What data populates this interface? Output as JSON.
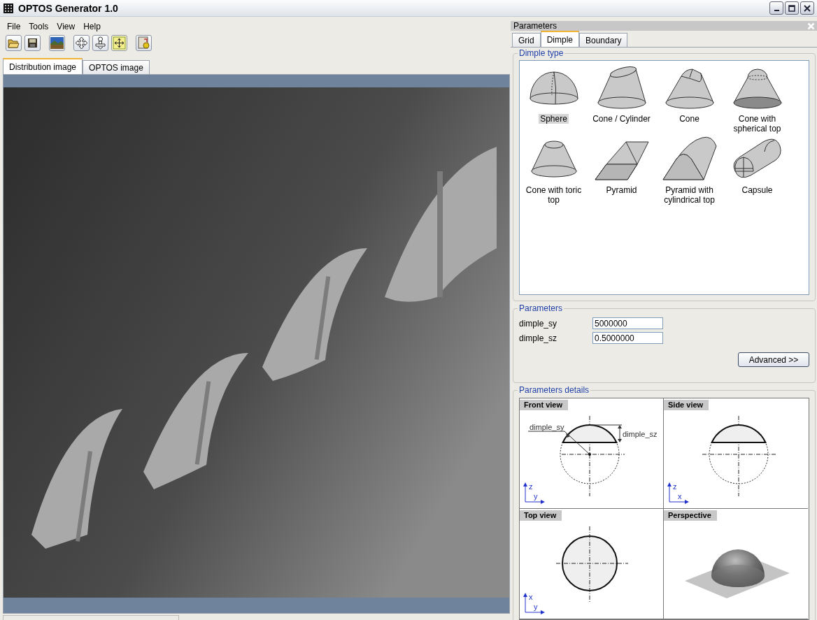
{
  "window": {
    "title": "OPTOS Generator 1.0"
  },
  "menu": [
    "File",
    "Tools",
    "View",
    "Help"
  ],
  "view_tabs": [
    {
      "label": "Distribution image",
      "selected": true
    },
    {
      "label": "OPTOS image",
      "selected": false
    }
  ],
  "panel": {
    "title": "Parameters",
    "tabs": [
      {
        "label": "Grid",
        "selected": false
      },
      {
        "label": "Dimple",
        "selected": true
      },
      {
        "label": "Boundary",
        "selected": false
      }
    ],
    "dimple_type": {
      "legend": "Dimple type",
      "items": [
        {
          "label": "Sphere",
          "kind": "sphere",
          "selected": true
        },
        {
          "label": "Cone / Cylinder",
          "kind": "cone_cylinder",
          "selected": false
        },
        {
          "label": "Cone",
          "kind": "cone",
          "selected": false
        },
        {
          "label": "Cone with spherical top",
          "kind": "cone_spherical",
          "selected": false
        },
        {
          "label": "Cone with toric top",
          "kind": "cone_toric",
          "selected": false
        },
        {
          "label": "Pyramid",
          "kind": "pyramid",
          "selected": false
        },
        {
          "label": "Pyramid with cylindrical top",
          "kind": "pyramid_cylindrical",
          "selected": false
        },
        {
          "label": "Capsule",
          "kind": "capsule",
          "selected": false
        }
      ]
    },
    "parameters": {
      "legend": "Parameters",
      "fields": [
        {
          "label": "dimple_sy",
          "value": "5000000"
        },
        {
          "label": "dimple_sz",
          "value": "0.5000000"
        }
      ],
      "button": "Advanced >>"
    },
    "details": {
      "legend": "Parameters details",
      "views": [
        {
          "title": "Front view",
          "kind": "front",
          "axes": [
            "z",
            "y"
          ],
          "labels": [
            "dimple_sy",
            "dimple_sz"
          ]
        },
        {
          "title": "Side view",
          "kind": "side",
          "axes": [
            "z",
            "x"
          ]
        },
        {
          "title": "Top view",
          "kind": "top",
          "axes": [
            "x",
            "y"
          ]
        },
        {
          "title": "Perspective",
          "kind": "perspective"
        }
      ]
    }
  }
}
